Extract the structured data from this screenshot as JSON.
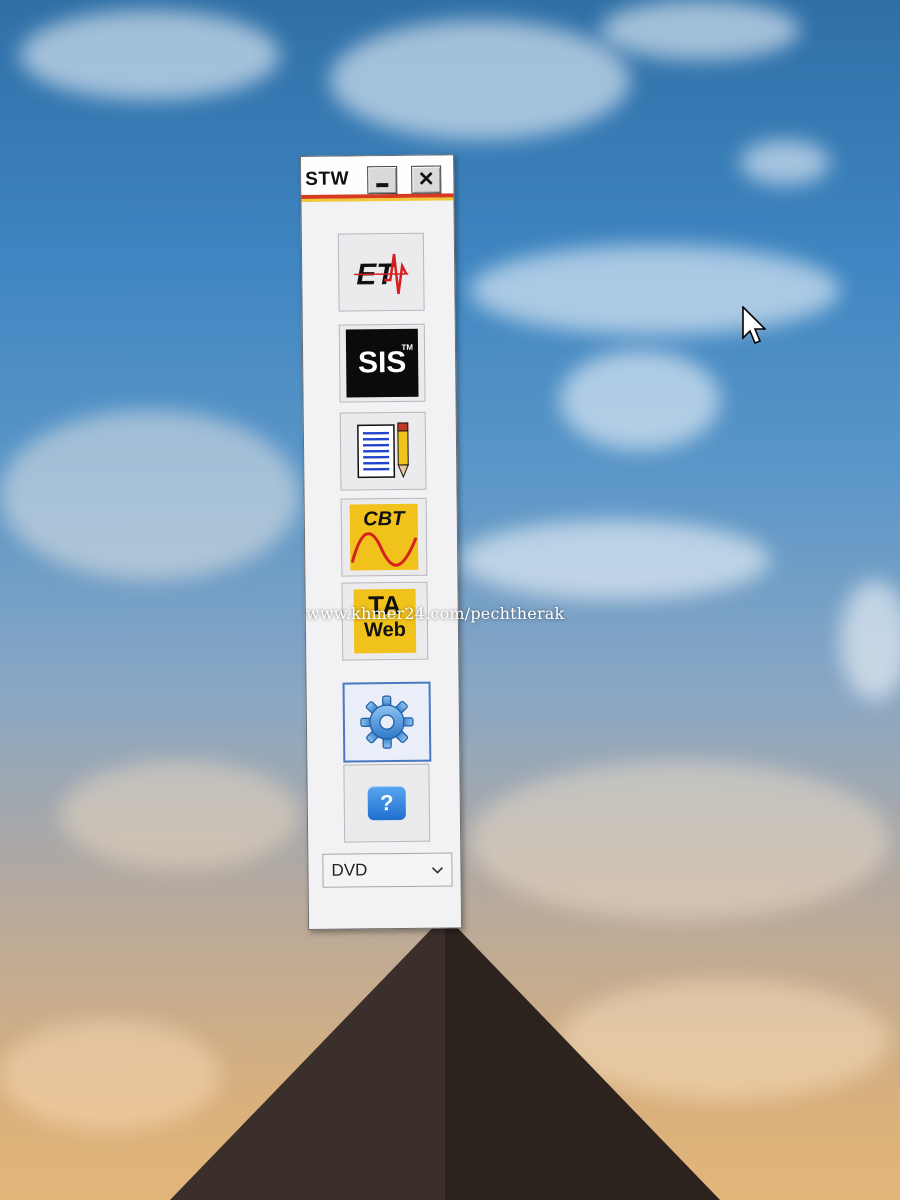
{
  "window": {
    "title": "STW",
    "minimize_icon": "minimize-icon",
    "close_icon": "close-icon"
  },
  "toolbar": {
    "buttons": [
      {
        "id": "et",
        "icon": "et-logo-icon"
      },
      {
        "id": "sis",
        "icon": "sis-logo-icon",
        "label": "SIS",
        "mark": "TM"
      },
      {
        "id": "document",
        "icon": "document-pencil-icon"
      },
      {
        "id": "cbt",
        "icon": "cbt-logo-icon",
        "label": "CBT"
      },
      {
        "id": "taweb",
        "icon": "taweb-logo-icon",
        "label_top": "TA",
        "label_bottom": "Web"
      },
      {
        "id": "settings",
        "icon": "gear-icon",
        "selected": true
      },
      {
        "id": "help",
        "icon": "help-icon",
        "label": "?"
      }
    ]
  },
  "drive_select": {
    "value": "DVD"
  },
  "watermark": "www.khmer24.com/pechtherak",
  "colors": {
    "title_stripe_red": "#d63a1f",
    "title_stripe_yellow": "#f0c83a",
    "logo_yellow": "#f1c21b",
    "selected_border": "#4a79c0"
  }
}
